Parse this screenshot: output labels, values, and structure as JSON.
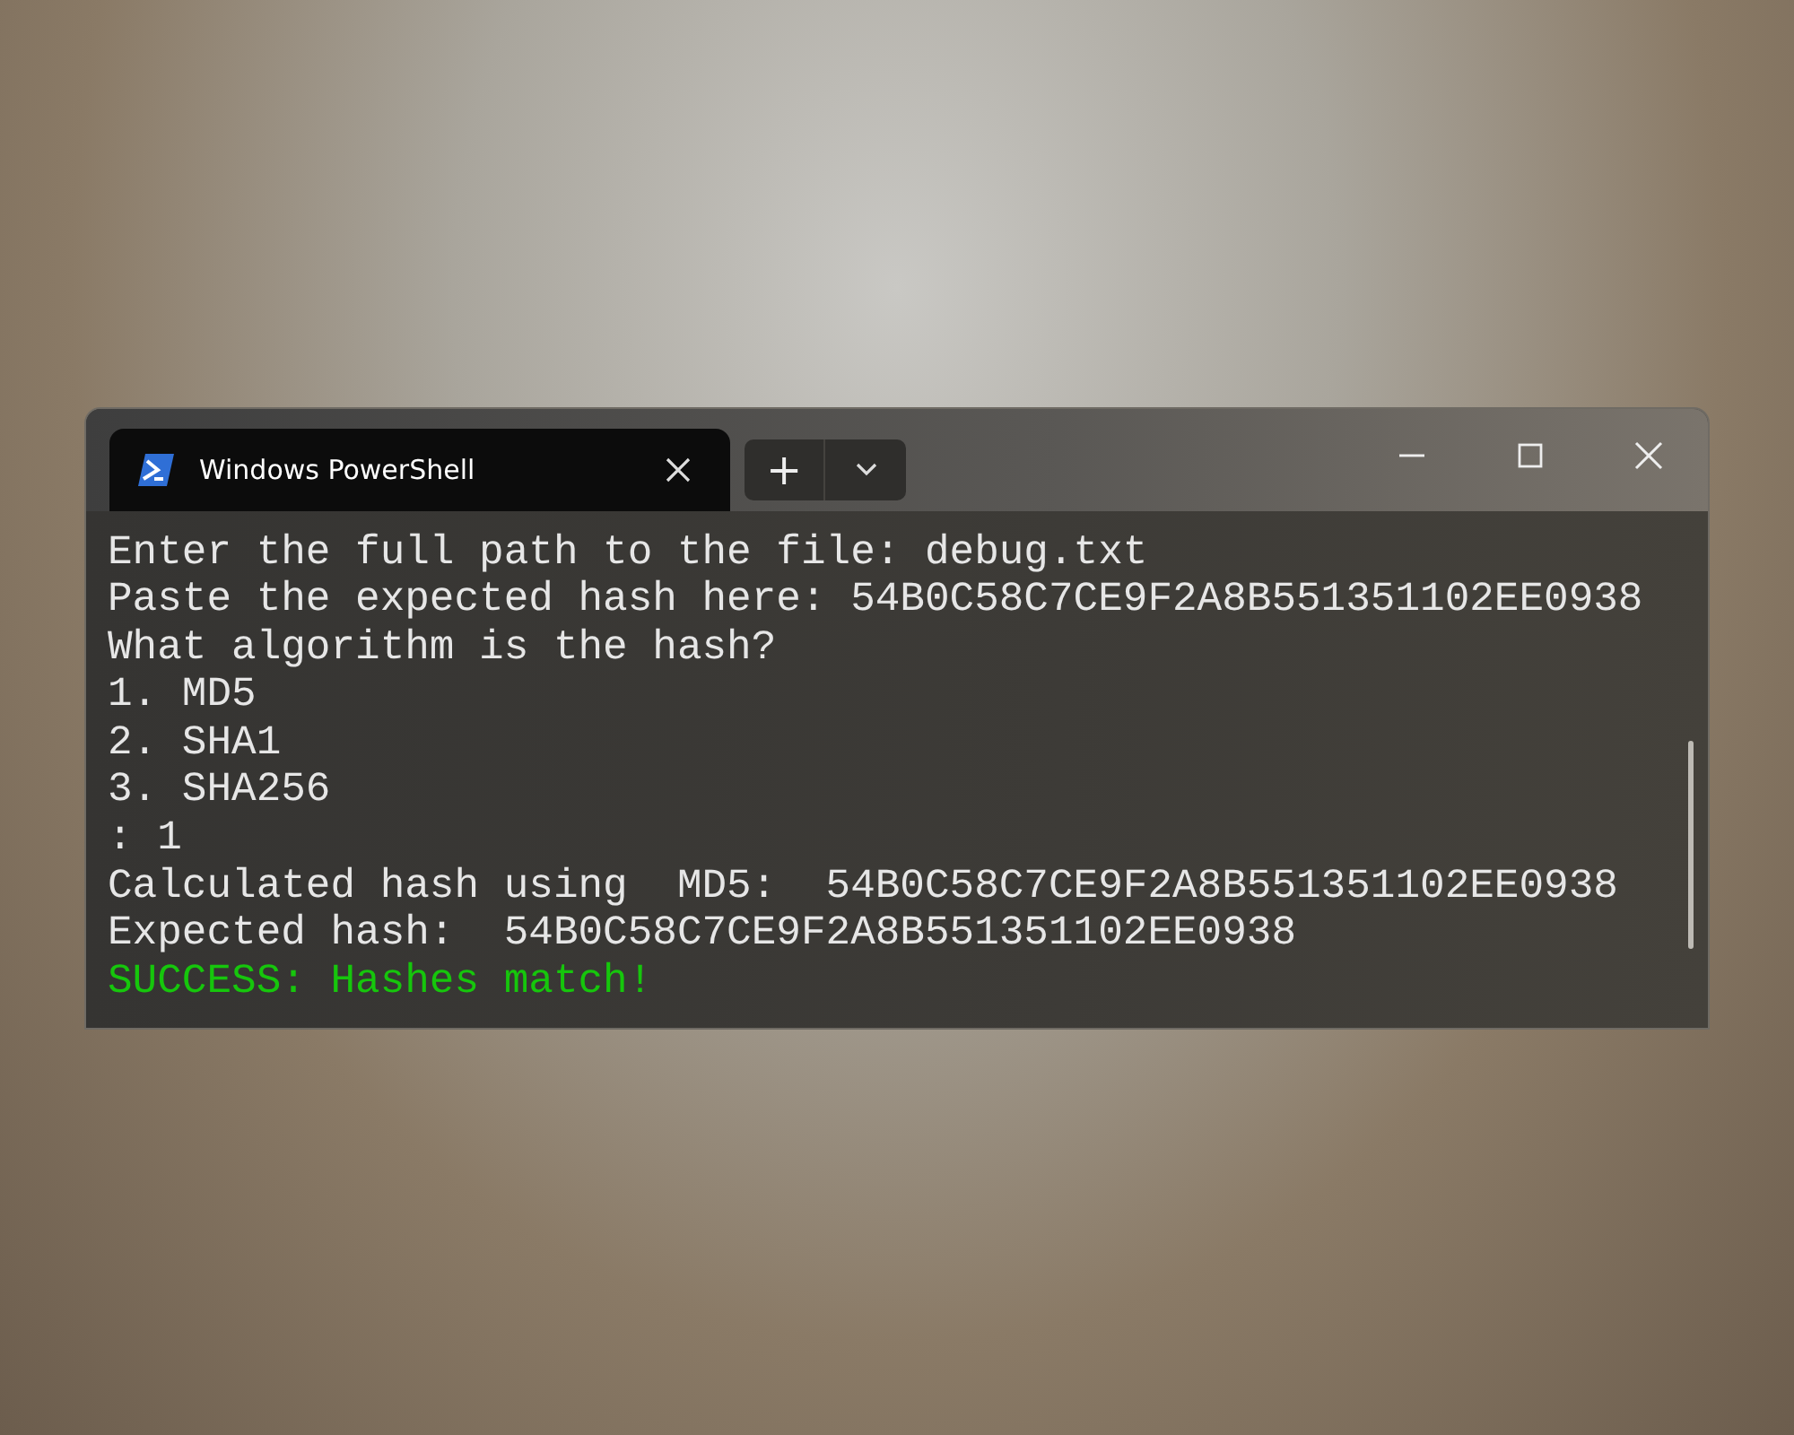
{
  "window": {
    "controls": [
      {
        "kind": "minimize"
      },
      {
        "kind": "maximize"
      },
      {
        "kind": "close"
      }
    ]
  },
  "tabs": [
    {
      "title": "Windows PowerShell",
      "selected": true
    }
  ],
  "new_tab_button": {
    "symbol": "+"
  },
  "terminal": {
    "lines": [
      {
        "kind": "normal",
        "text": "Enter the full path to the file: debug.txt"
      },
      {
        "kind": "normal",
        "text": "Paste the expected hash here: 54B0C58C7CE9F2A8B551351102EE0938"
      },
      {
        "kind": "normal",
        "text": "What algorithm is the hash?"
      },
      {
        "kind": "normal",
        "text": "1. MD5"
      },
      {
        "kind": "normal",
        "text": "2. SHA1"
      },
      {
        "kind": "normal",
        "text": "3. SHA256"
      },
      {
        "kind": "normal",
        "text": ": 1"
      },
      {
        "kind": "normal",
        "text": "Calculated hash using  MD5:  54B0C58C7CE9F2A8B551351102EE0938"
      },
      {
        "kind": "normal",
        "text": "Expected hash:  54B0C58C7CE9F2A8B551351102EE0938"
      },
      {
        "kind": "success",
        "text": "SUCCESS: Hashes match!"
      }
    ]
  }
}
